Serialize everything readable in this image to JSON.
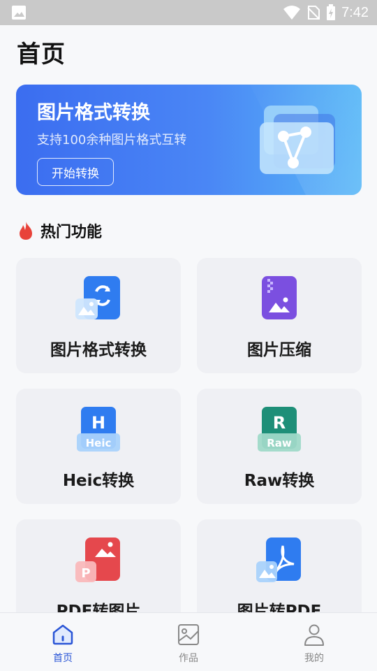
{
  "status_bar": {
    "time": "7:42"
  },
  "page": {
    "title": "首页"
  },
  "banner": {
    "title": "图片格式转换",
    "subtitle": "支持100余种图片格式互转",
    "button_label": "开始转换"
  },
  "section": {
    "title": "热门功能",
    "icon": "flame-icon"
  },
  "features": [
    {
      "label": "图片格式转换",
      "icon": "image-convert-icon"
    },
    {
      "label": "图片压缩",
      "icon": "image-compress-icon"
    },
    {
      "label": "Heic转换",
      "icon": "heic-icon",
      "icon_text": "H",
      "badge_text": "Heic"
    },
    {
      "label": "Raw转换",
      "icon": "raw-icon",
      "icon_text": "R",
      "badge_text": "Raw"
    },
    {
      "label": "PDF转图片",
      "icon": "pdf-to-image-icon",
      "badge_text": "P"
    },
    {
      "label": "图片转PDF",
      "icon": "image-to-pdf-icon"
    }
  ],
  "nav": {
    "items": [
      {
        "label": "首页",
        "icon": "home-icon",
        "active": true
      },
      {
        "label": "作品",
        "icon": "gallery-icon",
        "active": false
      },
      {
        "label": "我的",
        "icon": "profile-icon",
        "active": false
      }
    ]
  },
  "colors": {
    "accent": "#2a55d6",
    "banner_start": "#3b6df0",
    "banner_end": "#59b8f7",
    "heic_green": "#1e8f78",
    "pdf_red": "#e5484d",
    "flame": "#e8433a"
  }
}
